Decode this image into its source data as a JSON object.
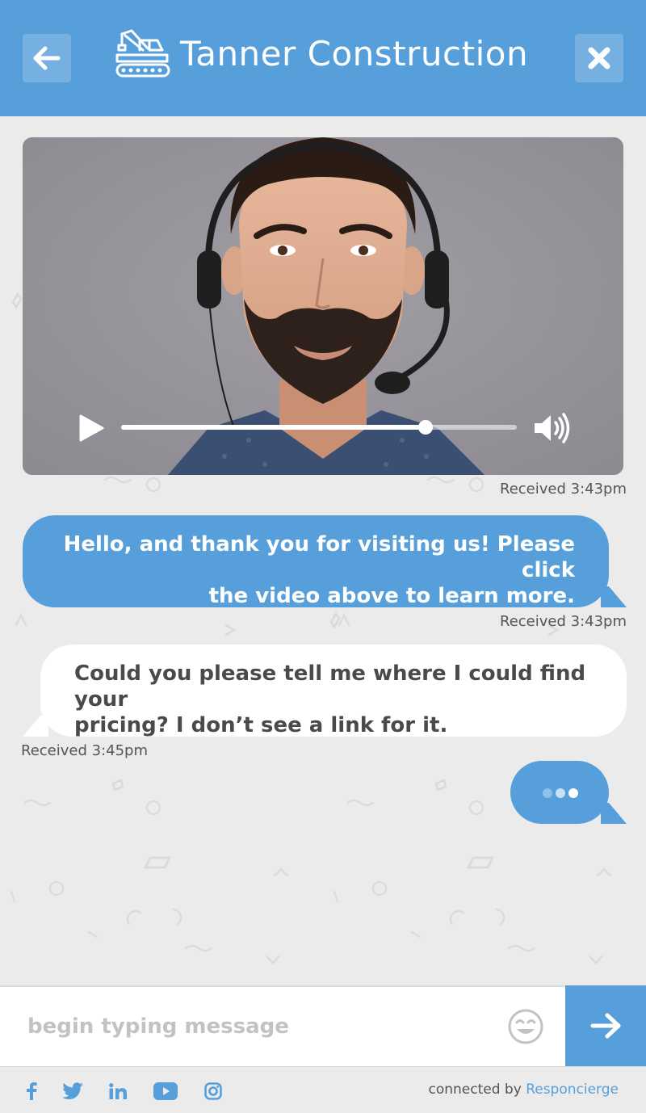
{
  "header": {
    "title": "Tanner Construction",
    "back_icon": "arrow-left-icon",
    "close_icon": "close-x-icon",
    "logo_icon": "crane-icon"
  },
  "video": {
    "play_icon": "play-icon",
    "volume_icon": "volume-icon",
    "progress_fraction": 0.77,
    "timestamp": "Received 3:43pm"
  },
  "messages": [
    {
      "sender": "agent",
      "lines": [
        "Hello, and thank you for visiting us! Please click",
        "the video above to learn more."
      ],
      "timestamp": "Received 3:43pm"
    },
    {
      "sender": "user",
      "lines": [
        "Could you please tell me where I could find your",
        "pricing? I don’t see a link for it."
      ],
      "timestamp": "Received 3:45pm"
    }
  ],
  "typing_indicator": {
    "dots": 3
  },
  "composer": {
    "placeholder": "begin typing message",
    "emoji_icon": "smiley-icon",
    "send_icon": "arrow-right-icon"
  },
  "footer": {
    "social": [
      "facebook-icon",
      "twitter-icon",
      "linkedin-icon",
      "youtube-icon",
      "instagram-icon"
    ],
    "credit_prefix": "connected by",
    "credit_brand": "Responcierge"
  },
  "colors": {
    "brand_blue": "#579fdb",
    "background": "#ebebeb",
    "bubble_user": "#ffffff",
    "text_dark": "#4a4a4a"
  }
}
